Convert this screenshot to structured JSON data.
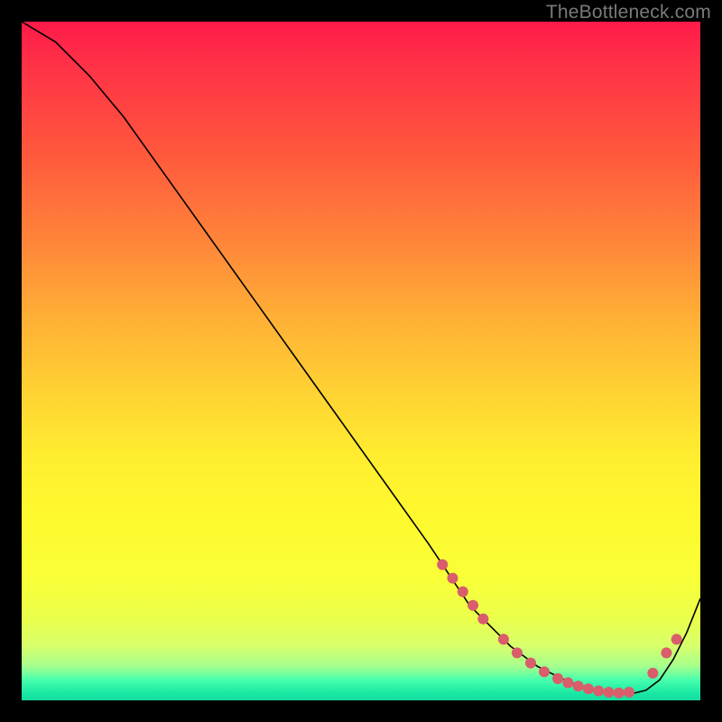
{
  "attribution": "TheBottleneck.com",
  "colors": {
    "background": "#000000",
    "curve": "#000000",
    "marker": "#d95d6b",
    "gradient_top": "#ff1a49",
    "gradient_bottom": "#15dca0"
  },
  "chart_data": {
    "type": "line",
    "title": "",
    "xlabel": "",
    "ylabel": "",
    "xlim": [
      0,
      100
    ],
    "ylim": [
      0,
      100
    ],
    "grid": false,
    "legend": false,
    "note": "Axes have no visible tick labels; values are estimated in 0–100 percentage space from chart geometry.",
    "series": [
      {
        "name": "curve",
        "x": [
          0,
          5,
          10,
          15,
          20,
          25,
          30,
          35,
          40,
          45,
          50,
          55,
          60,
          62,
          64,
          66,
          68,
          70,
          72,
          74,
          76,
          78,
          80,
          82,
          84,
          86,
          88,
          90,
          92,
          94,
          96,
          98,
          100
        ],
        "y": [
          100,
          97,
          92,
          86,
          79,
          72,
          65,
          58,
          51,
          44,
          37,
          30,
          23,
          20,
          17,
          14,
          12,
          10,
          8,
          6.5,
          5,
          4,
          3,
          2.2,
          1.6,
          1.2,
          1,
          1,
          1.5,
          3,
          6,
          10,
          15
        ]
      }
    ],
    "markers": {
      "name": "highlighted-points",
      "color": "#d95d6b",
      "points": [
        {
          "x": 62,
          "y": 20
        },
        {
          "x": 63.5,
          "y": 18
        },
        {
          "x": 65,
          "y": 16
        },
        {
          "x": 66.5,
          "y": 14
        },
        {
          "x": 68,
          "y": 12
        },
        {
          "x": 71,
          "y": 9
        },
        {
          "x": 73,
          "y": 7
        },
        {
          "x": 75,
          "y": 5.5
        },
        {
          "x": 77,
          "y": 4.2
        },
        {
          "x": 79,
          "y": 3.2
        },
        {
          "x": 80.5,
          "y": 2.6
        },
        {
          "x": 82,
          "y": 2.1
        },
        {
          "x": 83.5,
          "y": 1.7
        },
        {
          "x": 85,
          "y": 1.4
        },
        {
          "x": 86.5,
          "y": 1.2
        },
        {
          "x": 88,
          "y": 1.1
        },
        {
          "x": 89.5,
          "y": 1.2
        },
        {
          "x": 93,
          "y": 4
        },
        {
          "x": 95,
          "y": 7
        },
        {
          "x": 96.5,
          "y": 9
        }
      ]
    }
  }
}
